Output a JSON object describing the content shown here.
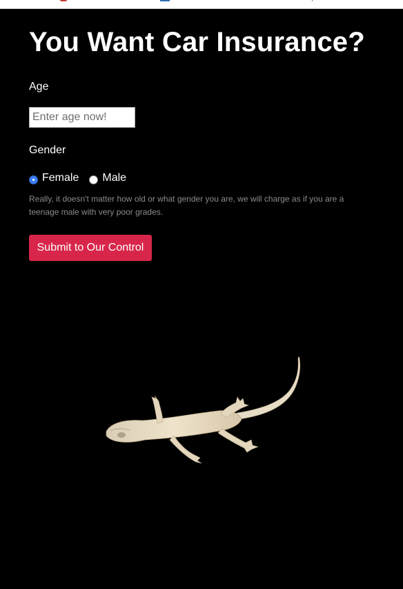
{
  "form": {
    "title": "You Want Car Insurance?",
    "age_label": "Age",
    "age_placeholder": "Enter age now!",
    "age_value": "",
    "gender_label": "Gender",
    "gender_options": [
      {
        "label": "Female",
        "selected": true
      },
      {
        "label": "Male",
        "selected": false
      }
    ],
    "help_text": "Really, it doesn't matter how old or what gender you are, we will charge as if you are a teenage male with very poor grades.",
    "submit_label": "Submit to Our Control"
  },
  "colors": {
    "background": "#000000",
    "submit": "#d8264a",
    "radio_selected": "#3b7cf0",
    "help_text": "#8b8b8b"
  },
  "icons": {
    "image": "gecko-image"
  }
}
